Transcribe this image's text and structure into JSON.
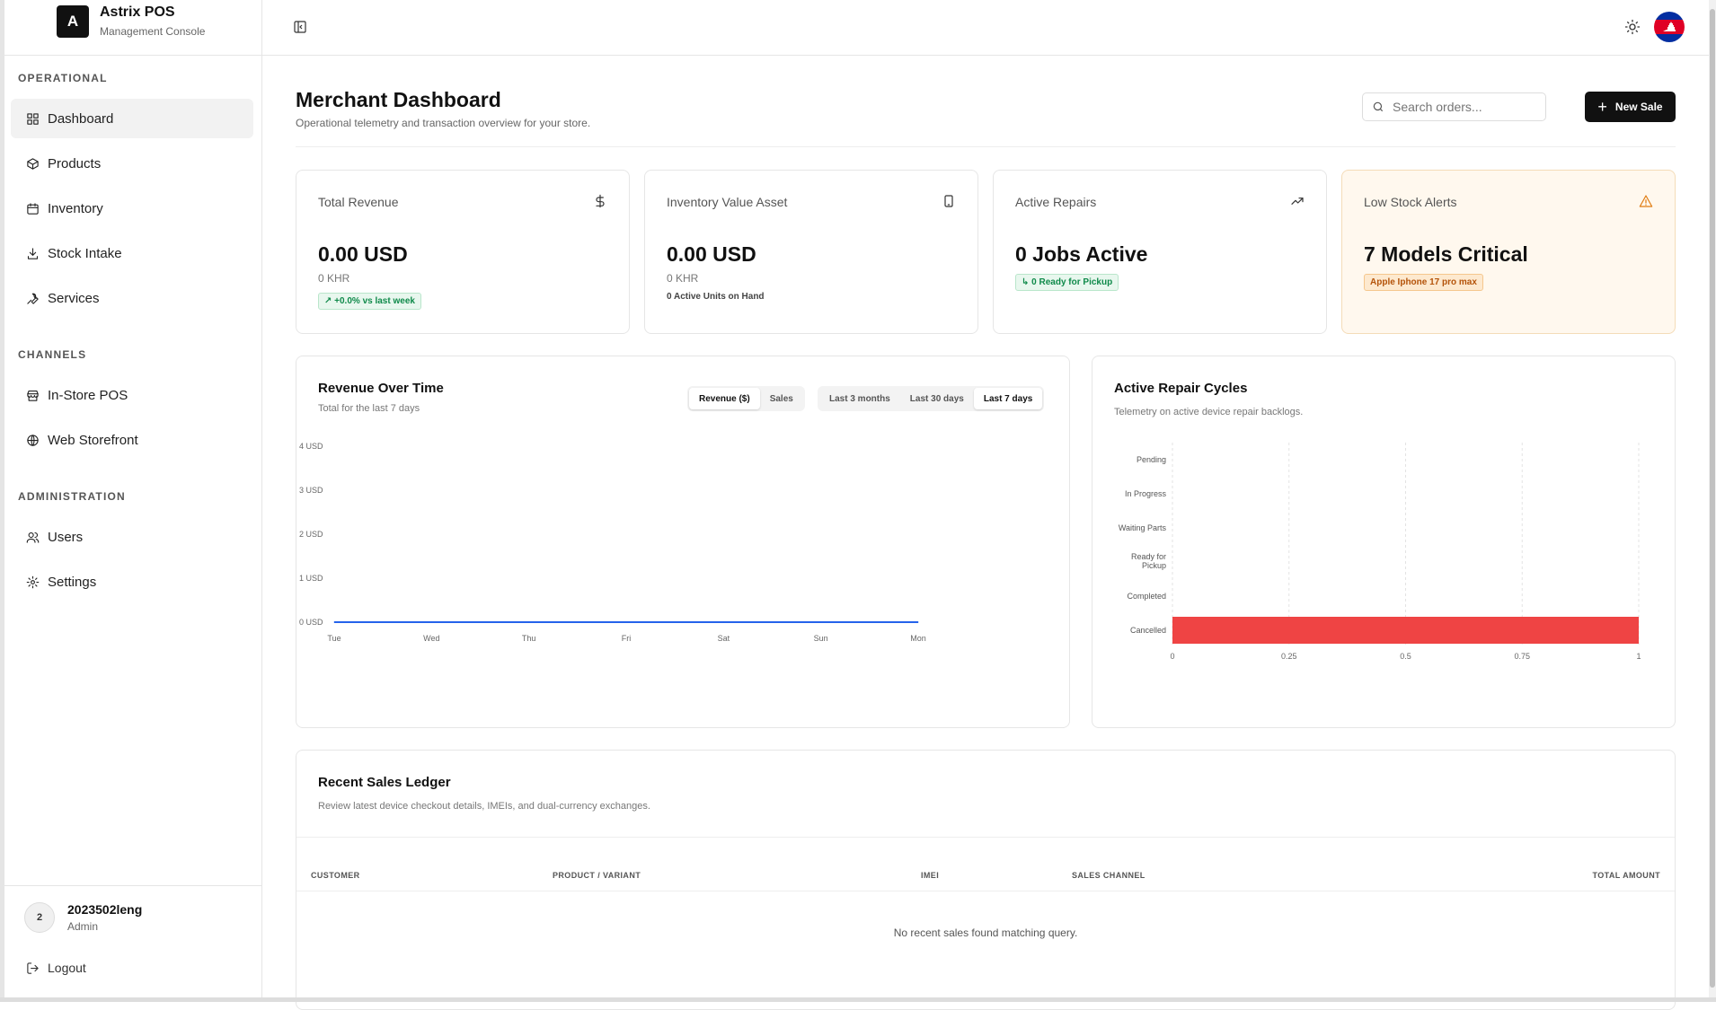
{
  "brand": {
    "logo_letter": "A",
    "title": "Astrix POS",
    "subtitle": "Management Console"
  },
  "sidebar": {
    "sections": [
      {
        "title": "OPERATIONAL",
        "items": [
          {
            "label": "Dashboard",
            "icon": "dashboard-icon",
            "active": true
          },
          {
            "label": "Products",
            "icon": "box-icon"
          },
          {
            "label": "Inventory",
            "icon": "calendar-icon"
          },
          {
            "label": "Stock Intake",
            "icon": "download-icon"
          },
          {
            "label": "Services",
            "icon": "wrench-icon"
          }
        ]
      },
      {
        "title": "CHANNELS",
        "items": [
          {
            "label": "In-Store POS",
            "icon": "store-icon"
          },
          {
            "label": "Web Storefront",
            "icon": "globe-icon"
          }
        ]
      },
      {
        "title": "ADMINISTRATION",
        "items": [
          {
            "label": "Users",
            "icon": "users-icon"
          },
          {
            "label": "Settings",
            "icon": "gear-icon"
          }
        ]
      }
    ],
    "user": {
      "initial": "2",
      "name": "2023502leng",
      "role": "Admin"
    },
    "logout_label": "Logout"
  },
  "header": {
    "title": "Merchant Dashboard",
    "subtitle": "Operational telemetry and transaction overview for your store.",
    "search_placeholder": "Search orders...",
    "new_sale_label": "New Sale"
  },
  "stats": [
    {
      "label": "Total Revenue",
      "value": "0.00 USD",
      "sub": "0 KHR",
      "badge": "↗ +0.0% vs last week",
      "icon": "dollar-icon"
    },
    {
      "label": "Inventory Value Asset",
      "value": "0.00 USD",
      "sub": "0 KHR",
      "note": "0 Active Units on Hand",
      "icon": "phone-icon"
    },
    {
      "label": "Active Repairs",
      "value": "0 Jobs Active",
      "badge": "↳ 0 Ready for Pickup",
      "icon": "trend-up-icon"
    },
    {
      "label": "Low Stock Alerts",
      "value": "7 Models Critical",
      "badge": "Apple Iphone 17 pro max",
      "icon": "warning-icon"
    }
  ],
  "revenue_chart": {
    "title": "Revenue Over Time",
    "subtitle": "Total for the last 7 days",
    "metric_toggle": [
      "Revenue ($)",
      "Sales"
    ],
    "metric_selected": "Revenue ($)",
    "range_toggle": [
      "Last 3 months",
      "Last 30 days",
      "Last 7 days"
    ],
    "range_selected": "Last 7 days"
  },
  "repair_chart": {
    "title": "Active Repair Cycles",
    "subtitle": "Telemetry on active device repair backlogs."
  },
  "chart_data": [
    {
      "type": "line",
      "categories": [
        "Tue",
        "Wed",
        "Thu",
        "Fri",
        "Sat",
        "Sun",
        "Mon"
      ],
      "series": [
        {
          "values": [
            0,
            0,
            0,
            0,
            0,
            0,
            0
          ],
          "color": "#2563eb"
        }
      ],
      "yticks": [
        "0 USD",
        "1 USD",
        "2 USD",
        "3 USD",
        "4 USD"
      ],
      "ylim": [
        0,
        4
      ],
      "grid": false
    },
    {
      "type": "bar",
      "orientation": "horizontal",
      "categories": [
        "Pending",
        "In Progress",
        "Waiting Parts",
        "Ready for Pickup",
        "Completed",
        "Cancelled"
      ],
      "values": [
        0,
        0,
        0,
        0,
        0,
        1
      ],
      "color": "#ef4444",
      "xticks": [
        "0",
        "0.25",
        "0.5",
        "0.75",
        "1"
      ],
      "xlim": [
        0,
        1
      ],
      "grid": true
    }
  ],
  "ledger": {
    "title": "Recent Sales Ledger",
    "subtitle": "Review latest device checkout details, IMEIs, and dual-currency exchanges.",
    "columns": [
      "CUSTOMER",
      "PRODUCT / VARIANT",
      "IMEI",
      "SALES CHANNEL",
      "TOTAL AMOUNT"
    ],
    "empty_message": "No recent sales found matching query."
  },
  "colors": {
    "accent": "#111111",
    "line": "#2563eb",
    "cancelled_bar": "#ef4444",
    "alert_bg": "#fff8ee"
  }
}
